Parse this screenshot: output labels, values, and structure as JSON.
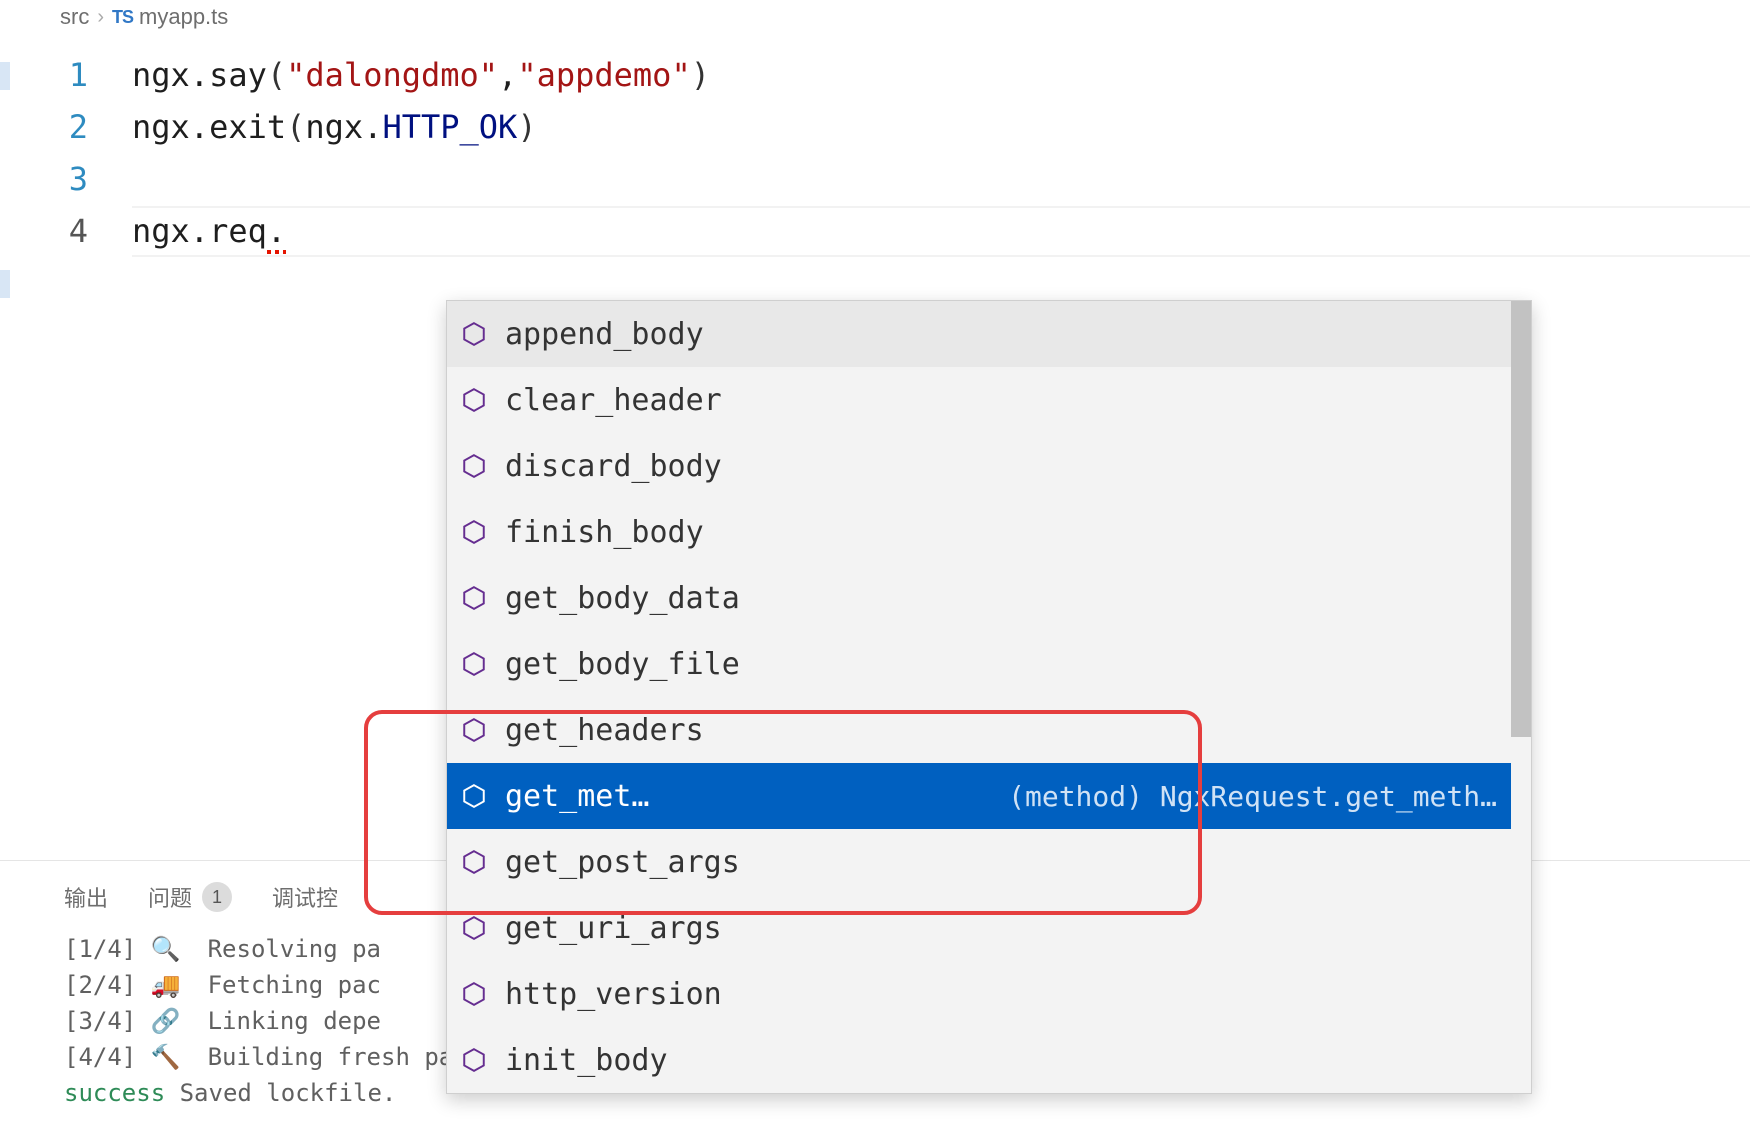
{
  "breadcrumb": {
    "folder": "src",
    "file_badge": "TS",
    "file_name": "myapp.ts"
  },
  "code": {
    "lines": [
      {
        "num": "1",
        "tokens": [
          "ngx",
          ".",
          "say",
          "(",
          "\"dalongdmo\"",
          ",",
          "\"appdemo\"",
          ")"
        ]
      },
      {
        "num": "2",
        "tokens": [
          "ngx",
          ".",
          "exit",
          "(",
          "ngx",
          ".",
          "HTTP_OK",
          ")"
        ]
      },
      {
        "num": "3",
        "tokens": []
      },
      {
        "num": "4",
        "tokens": [
          "ngx",
          ".",
          "req",
          "."
        ]
      }
    ]
  },
  "autocomplete": {
    "items": [
      {
        "label": "append_body",
        "highlight": true
      },
      {
        "label": "clear_header"
      },
      {
        "label": "discard_body"
      },
      {
        "label": "finish_body"
      },
      {
        "label": "get_body_data"
      },
      {
        "label": "get_body_file"
      },
      {
        "label": "get_headers"
      },
      {
        "label": "get_met…",
        "selected": true,
        "detail": "(method) NgxRequest.get_meth…"
      },
      {
        "label": "get_post_args"
      },
      {
        "label": "get_uri_args"
      },
      {
        "label": "http_version"
      },
      {
        "label": "init_body"
      }
    ]
  },
  "panel": {
    "tabs": {
      "output": "输出",
      "problems": "问题",
      "problems_count": "1",
      "debug_console": "调试控"
    },
    "terminal_lines": [
      {
        "prefix": "[1/4]",
        "emoji": "🔍",
        "text": "Resolving pa"
      },
      {
        "prefix": "[2/4]",
        "emoji": "🚚",
        "text": "Fetching pac"
      },
      {
        "prefix": "[3/4]",
        "emoji": "🔗",
        "text": "Linking depe"
      },
      {
        "prefix": "[4/4]",
        "emoji": "🔨",
        "text": "Building fresh packages..."
      }
    ],
    "success_prefix": "success",
    "success_text": " Saved lockfile."
  }
}
